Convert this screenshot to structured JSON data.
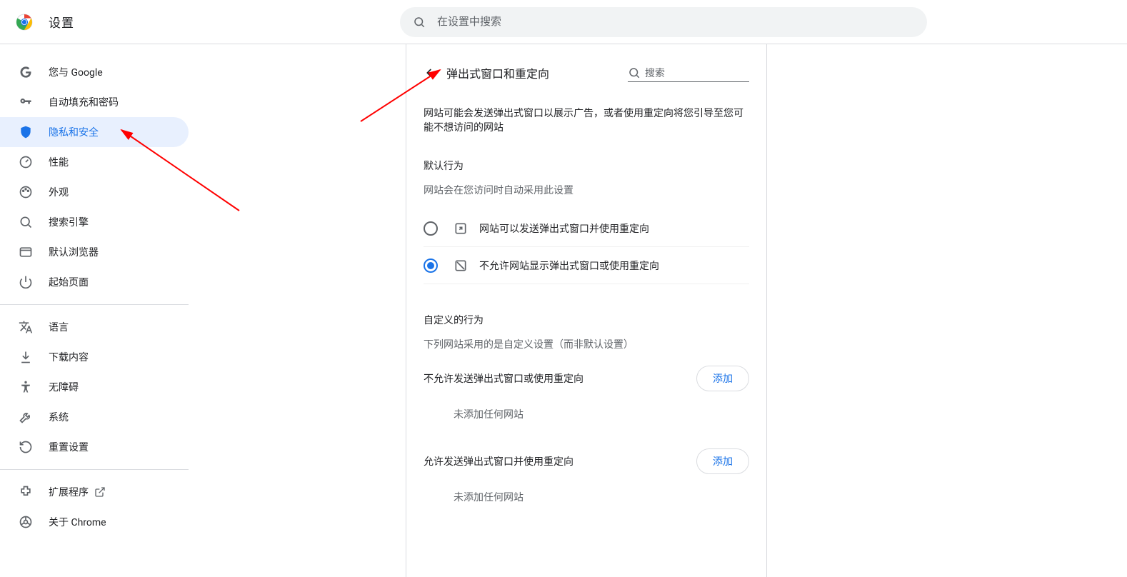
{
  "topbar": {
    "title": "设置",
    "search_placeholder": "在设置中搜索"
  },
  "sidebar": {
    "items": [
      {
        "id": "you-and-google",
        "label": "您与 Google"
      },
      {
        "id": "autofill",
        "label": "自动填充和密码"
      },
      {
        "id": "privacy",
        "label": "隐私和安全"
      },
      {
        "id": "performance",
        "label": "性能"
      },
      {
        "id": "appearance",
        "label": "外观"
      },
      {
        "id": "search-engine",
        "label": "搜索引擎"
      },
      {
        "id": "default-browser",
        "label": "默认浏览器"
      },
      {
        "id": "on-startup",
        "label": "起始页面"
      }
    ],
    "items2": [
      {
        "id": "languages",
        "label": "语言"
      },
      {
        "id": "downloads",
        "label": "下载内容"
      },
      {
        "id": "accessibility",
        "label": "无障碍"
      },
      {
        "id": "system",
        "label": "系统"
      },
      {
        "id": "reset",
        "label": "重置设置"
      }
    ],
    "items3": [
      {
        "id": "extensions",
        "label": "扩展程序"
      },
      {
        "id": "about",
        "label": "关于 Chrome"
      }
    ]
  },
  "page": {
    "title": "弹出式窗口和重定向",
    "search_placeholder": "搜索",
    "description": "网站可能会发送弹出式窗口以展示广告，或者使用重定向将您引导至您可能不想访问的网站",
    "default_section_title": "默认行为",
    "default_section_sub": "网站会在您访问时自动采用此设置",
    "radio_allow": "网站可以发送弹出式窗口并使用重定向",
    "radio_block": "不允许网站显示弹出式窗口或使用重定向",
    "custom_section_title": "自定义的行为",
    "custom_section_sub": "下列网站采用的是自定义设置（而非默认设置）",
    "block_list_title": "不允许发送弹出式窗口或使用重定向",
    "allow_list_title": "允许发送弹出式窗口并使用重定向",
    "add_label": "添加",
    "empty_label": "未添加任何网站"
  }
}
